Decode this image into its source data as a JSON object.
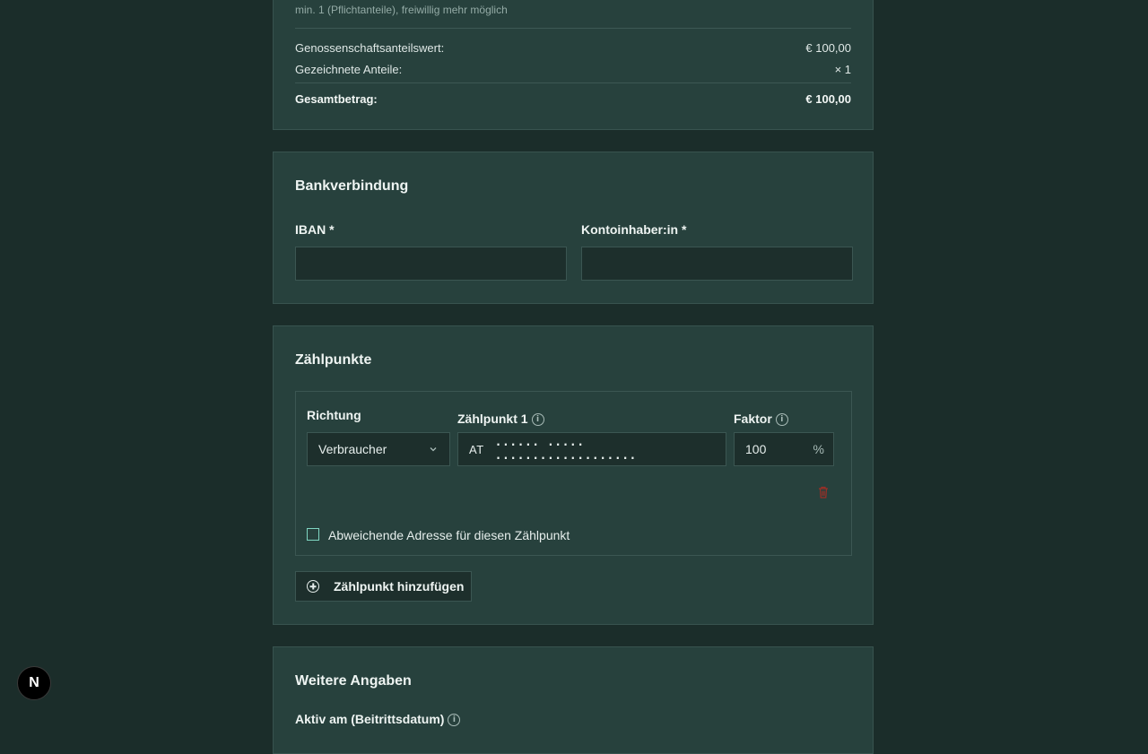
{
  "shares": {
    "hint": "min. 1 (Pflichtanteile), freiwillig mehr möglich",
    "share_value_label": "Genossenschaftsanteilswert:",
    "share_value": "€ 100,00",
    "subscribed_label": "Gezeichnete Anteile:",
    "subscribed_value": "× 1",
    "total_label": "Gesamtbetrag:",
    "total_value": "€ 100,00"
  },
  "bank": {
    "title": "Bankverbindung",
    "iban_label": "IBAN *",
    "iban_value": "",
    "holder_label": "Kontoinhaber:in *",
    "holder_value": ""
  },
  "meter": {
    "title": "Zählpunkte",
    "direction_label": "Richtung",
    "direction_value": "Verbraucher",
    "meter_label": "Zählpunkt 1",
    "meter_prefix": "AT",
    "meter_mask": "...... ..... ...................",
    "factor_label": "Faktor",
    "factor_value": "100",
    "factor_unit": "%",
    "alt_address_label": "Abweichende Adresse für diesen Zählpunkt",
    "add_button": "Zählpunkt hinzufügen"
  },
  "more": {
    "title": "Weitere Angaben",
    "active_label": "Aktiv am (Beitrittsdatum)"
  },
  "badge": {
    "letter": "N"
  },
  "colors": {
    "accent": "#7fd6c2",
    "danger": "#c0392b",
    "background": "#1b2d2a",
    "card": "#27413d"
  }
}
